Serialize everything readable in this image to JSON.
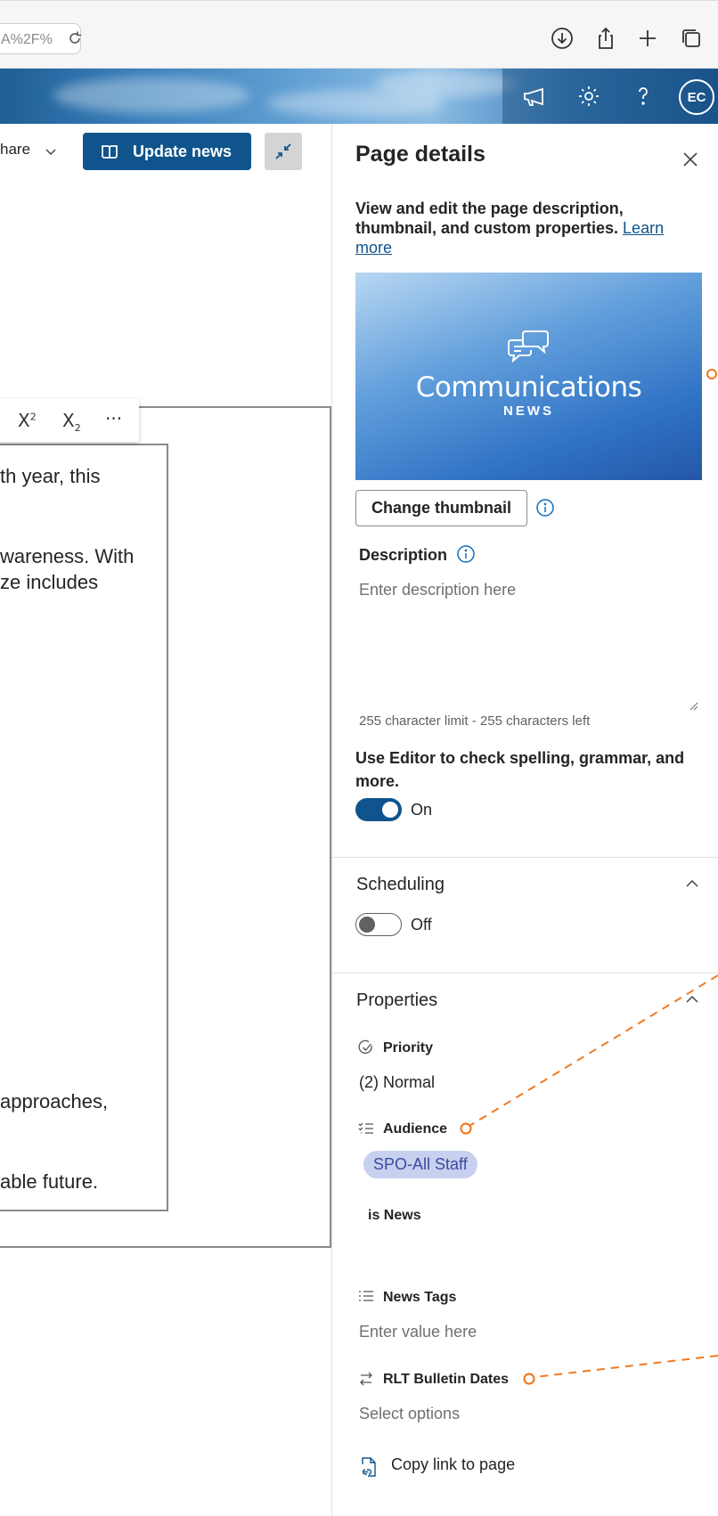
{
  "browser": {
    "url_fragment": "A%2F%",
    "icons": [
      "reload-icon",
      "download-icon",
      "share-icon",
      "new-tab-icon",
      "tabs-icon"
    ]
  },
  "header": {
    "icons": [
      "megaphone-icon",
      "gear-icon",
      "help-icon"
    ],
    "avatar_initials": "EC"
  },
  "toolbar": {
    "share_label": "hare",
    "update_news_label": "Update news"
  },
  "text_toolbar": {
    "superscript_label": "X",
    "subscript_label": "X",
    "more_label": "···"
  },
  "editor_fragments": [
    "th year, this",
    "wareness. With",
    "ze includes",
    " approaches,",
    "able future."
  ],
  "panel": {
    "title": "Page details",
    "description_text": "View and edit the page description, thumbnail, and custom properties.",
    "learn_more": "Learn more",
    "thumbnail": {
      "title": "Communications",
      "subtitle": "NEWS"
    },
    "change_thumbnail_label": "Change thumbnail",
    "description_label": "Description",
    "description_placeholder": "Enter description here",
    "char_limit": "255 character limit - 255 characters left",
    "editor_label": "Use Editor to check spelling, grammar, and more.",
    "editor_toggle": "On",
    "scheduling": {
      "title": "Scheduling",
      "toggle": "Off"
    },
    "properties": {
      "title": "Properties",
      "priority_label": "Priority",
      "priority_value": "(2) Normal",
      "audience_label": "Audience",
      "audience_value": "SPO-All Staff",
      "is_news_label": "is News",
      "news_tags_label": "News Tags",
      "news_tags_placeholder": "Enter value here",
      "rlt_label": "RLT Bulletin Dates",
      "rlt_placeholder": "Select options"
    },
    "copy_link_label": "Copy link to page"
  },
  "colors": {
    "primary": "#0f548c",
    "annotation": "#f07a22",
    "pill_bg": "#c7d0ee"
  }
}
